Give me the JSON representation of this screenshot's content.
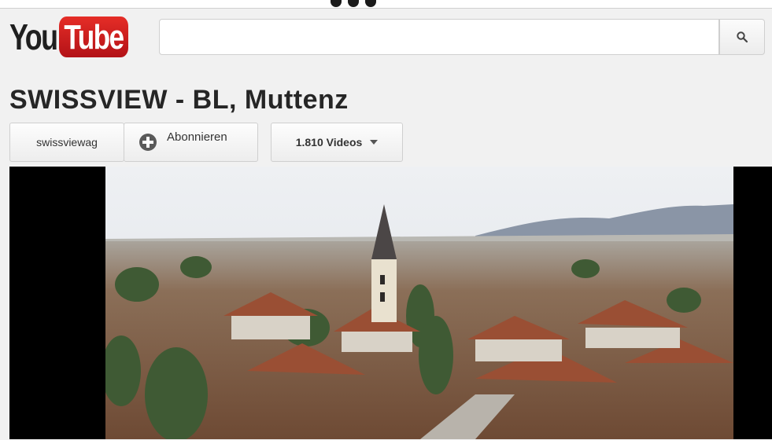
{
  "logo": {
    "you": "You",
    "tube": "Tube"
  },
  "search": {
    "value": "",
    "placeholder": "",
    "button_icon": "search-icon"
  },
  "channel": {
    "title": "SWISSVIEW - BL, Muttenz",
    "user_button": "swissviewag",
    "subscribe_label": "Abonnieren",
    "videos_label": "1.810 Videos"
  },
  "video": {
    "scene": "aerial view of Muttenz village with church tower",
    "sky_color": "#e6e9ee",
    "roof_color": "#8a5a3e"
  },
  "colors": {
    "brand_red": "#e52d27",
    "page_bg": "#f1f1f1"
  }
}
